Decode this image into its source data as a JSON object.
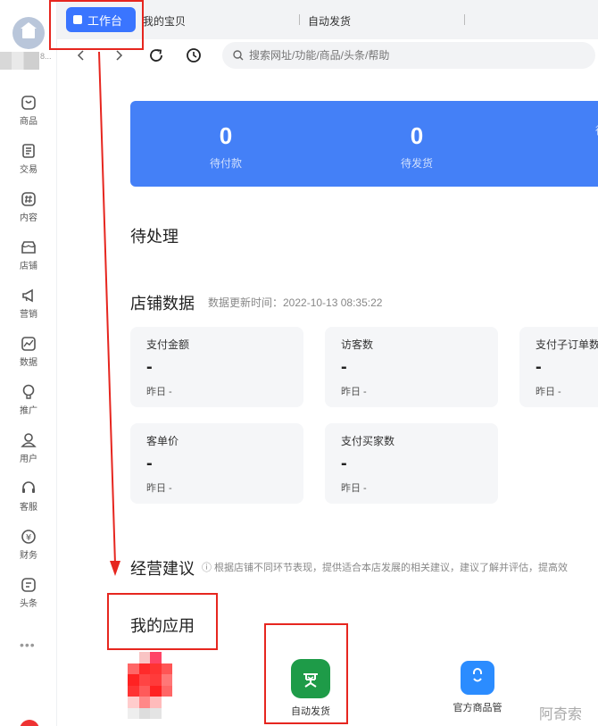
{
  "sidebar": {
    "shop_name_suffix": "8...",
    "items": [
      {
        "label": "商品",
        "icon": "product-icon"
      },
      {
        "label": "交易",
        "icon": "trade-icon"
      },
      {
        "label": "内容",
        "icon": "content-icon"
      },
      {
        "label": "店铺",
        "icon": "shop-icon"
      },
      {
        "label": "营销",
        "icon": "marketing-icon"
      },
      {
        "label": "数据",
        "icon": "data-icon"
      },
      {
        "label": "推广",
        "icon": "promotion-icon"
      },
      {
        "label": "用户",
        "icon": "user-icon"
      },
      {
        "label": "客服",
        "icon": "customer-service-icon"
      },
      {
        "label": "财务",
        "icon": "finance-icon"
      },
      {
        "label": "头条",
        "icon": "headline-icon"
      }
    ],
    "more": "•••"
  },
  "tabs": {
    "active": "工作台",
    "items": [
      "我的宝贝",
      "自动发货"
    ]
  },
  "search": {
    "placeholder": "搜索网址/功能/商品/头条/帮助"
  },
  "stats": [
    {
      "value": "0",
      "label": "待付款"
    },
    {
      "value": "0",
      "label": "待发货"
    },
    {
      "value": "",
      "label": "待"
    }
  ],
  "pending": {
    "title": "待处理"
  },
  "shop_data": {
    "title": "店铺数据",
    "update_time": "数据更新时间：2022-10-13 08:35:22",
    "cards": [
      {
        "title": "支付金额",
        "value": "-",
        "prev": "昨日 -"
      },
      {
        "title": "访客数",
        "value": "-",
        "prev": "昨日 -"
      },
      {
        "title": "支付子订单数",
        "value": "-",
        "prev": "昨日 -"
      },
      {
        "title": "客单价",
        "value": "-",
        "prev": "昨日 -"
      },
      {
        "title": "支付买家数",
        "value": "-",
        "prev": "昨日 -"
      }
    ]
  },
  "advice": {
    "title": "经营建议",
    "hint": "ⓘ 根据店铺不同环节表现，提供适合本店发展的相关建议，建议了解并评估，提高效"
  },
  "my_apps": {
    "title": "我的应用",
    "items": [
      {
        "label": "自动发货",
        "color": "#1e9b48"
      },
      {
        "label": "官方商品管",
        "color": "#2b8cff"
      }
    ]
  },
  "watermark": "阿奇索",
  "colors": {
    "accent": "#3a75ff",
    "stats_bg": "#4480f7",
    "annotation": "#e6261f"
  }
}
